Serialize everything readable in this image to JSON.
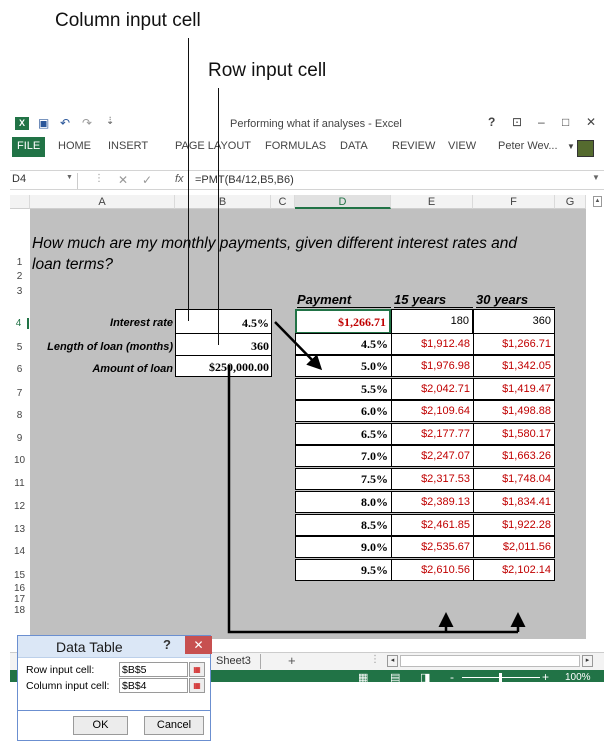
{
  "callouts": {
    "column_input": "Column input cell",
    "row_input": "Row input cell"
  },
  "window": {
    "title": "Performing what if analyses - Excel",
    "help": "?",
    "restore": "⊡",
    "minimize": "–",
    "maximize": "□",
    "close": "✕"
  },
  "ribbon": {
    "tabs": [
      "FILE",
      "HOME",
      "INSERT",
      "PAGE LAYOUT",
      "FORMULAS",
      "DATA",
      "REVIEW",
      "VIEW"
    ],
    "user": "Peter Wev..."
  },
  "formula_bar": {
    "name_box": "D4",
    "fx": "fx",
    "formula": "=PMT(B4/12,B5,B6)"
  },
  "columns": [
    "A",
    "B",
    "C",
    "D",
    "E",
    "F",
    "G"
  ],
  "rows": [
    "1",
    "2",
    "3",
    "4",
    "5",
    "6",
    "7",
    "8",
    "9",
    "10",
    "11",
    "12",
    "13",
    "14",
    "15",
    "16",
    "17",
    "18"
  ],
  "sheet": {
    "heading": "How much are my monthly payments, given different interest rates and loan terms?",
    "inputs": [
      {
        "label": "Interest rate",
        "value": "4.5%"
      },
      {
        "label": "Length of loan (months)",
        "value": "360"
      },
      {
        "label": "Amount of loan",
        "value": "$250,000.00"
      }
    ],
    "table_headers": {
      "payment": "Payment",
      "y15": "15 years",
      "y30": "30 years"
    },
    "formula_row": {
      "payment": "$1,266.71",
      "y15": "180",
      "y30": "360"
    },
    "rows": [
      {
        "rate": "4.5%",
        "y15": "$1,912.48",
        "y30": "$1,266.71"
      },
      {
        "rate": "5.0%",
        "y15": "$1,976.98",
        "y30": "$1,342.05"
      },
      {
        "rate": "5.5%",
        "y15": "$2,042.71",
        "y30": "$1,419.47"
      },
      {
        "rate": "6.0%",
        "y15": "$2,109.64",
        "y30": "$1,498.88"
      },
      {
        "rate": "6.5%",
        "y15": "$2,177.77",
        "y30": "$1,580.17"
      },
      {
        "rate": "7.0%",
        "y15": "$2,247.07",
        "y30": "$1,663.26"
      },
      {
        "rate": "7.5%",
        "y15": "$2,317.53",
        "y30": "$1,748.04"
      },
      {
        "rate": "8.0%",
        "y15": "$2,389.13",
        "y30": "$1,834.41"
      },
      {
        "rate": "8.5%",
        "y15": "$2,461.85",
        "y30": "$1,922.28"
      },
      {
        "rate": "9.0%",
        "y15": "$2,535.67",
        "y30": "$2,011.56"
      },
      {
        "rate": "9.5%",
        "y15": "$2,610.56",
        "y30": "$2,102.14"
      }
    ]
  },
  "sheet_tabs": {
    "tab": "Sheet3",
    "add": "+"
  },
  "status": {
    "zoom": "100%",
    "minus": "-",
    "plus": "+"
  },
  "dialog": {
    "title": "Data Table",
    "help": "?",
    "close": "✕",
    "row_label": "Row input cell:",
    "row_value": "$B$5",
    "col_label": "Column input cell:",
    "col_value": "$B$4",
    "ok": "OK",
    "cancel": "Cancel"
  },
  "colors": {
    "excel_green": "#217346",
    "red_values": "#c00000",
    "sheet_gray": "#c0c0c0",
    "dialog_close": "#c75050"
  }
}
